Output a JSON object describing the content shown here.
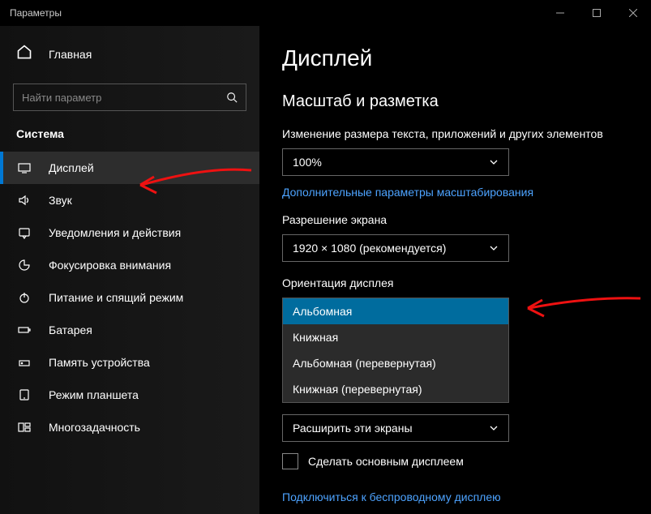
{
  "window": {
    "title": "Параметры"
  },
  "sidebar": {
    "home_label": "Главная",
    "search_placeholder": "Найти параметр",
    "section_label": "Система",
    "items": [
      {
        "label": "Дисплей"
      },
      {
        "label": "Звук"
      },
      {
        "label": "Уведомления и действия"
      },
      {
        "label": "Фокусировка внимания"
      },
      {
        "label": "Питание и спящий режим"
      },
      {
        "label": "Батарея"
      },
      {
        "label": "Память устройства"
      },
      {
        "label": "Режим планшета"
      },
      {
        "label": "Многозадачность"
      }
    ]
  },
  "main": {
    "page_title": "Дисплей",
    "group_title": "Масштаб и разметка",
    "scale_label": "Изменение размера текста, приложений и других элементов",
    "scale_value": "100%",
    "scale_advanced_link": "Дополнительные параметры масштабирования",
    "resolution_label": "Разрешение экрана",
    "resolution_value": "1920 × 1080 (рекомендуется)",
    "orientation_label": "Ориентация дисплея",
    "orientation_options": [
      "Альбомная",
      "Книжная",
      "Альбомная (перевернутая)",
      "Книжная (перевернутая)"
    ],
    "multi_display_value": "Расширить эти экраны",
    "primary_checkbox_label": "Сделать основным дисплеем",
    "wireless_link": "Подключиться к беспроводному дисплею"
  }
}
